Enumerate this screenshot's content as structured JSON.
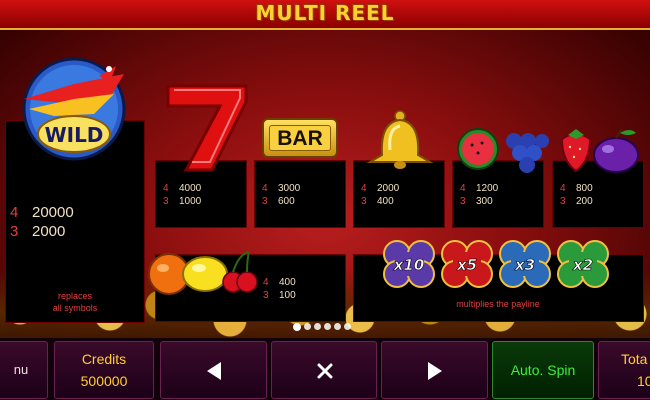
{
  "game": {
    "title": "MULTI REEL"
  },
  "wild": {
    "label": "WILD",
    "pays": [
      {
        "count": "4",
        "value": "20000"
      },
      {
        "count": "3",
        "value": "2000"
      }
    ],
    "desc_line1": "replaces",
    "desc_line2": "all symbols"
  },
  "symbols": {
    "seven": {
      "pays": [
        {
          "count": "4",
          "value": "4000"
        },
        {
          "count": "3",
          "value": "1000"
        }
      ]
    },
    "bar": {
      "label": "BAR",
      "pays": [
        {
          "count": "4",
          "value": "3000"
        },
        {
          "count": "3",
          "value": "600"
        }
      ]
    },
    "bell": {
      "pays": [
        {
          "count": "4",
          "value": "2000"
        },
        {
          "count": "3",
          "value": "400"
        }
      ]
    },
    "melon_grapes": {
      "pays": [
        {
          "count": "4",
          "value": "1200"
        },
        {
          "count": "3",
          "value": "300"
        }
      ]
    },
    "strawberry_plum": {
      "pays": [
        {
          "count": "4",
          "value": "800"
        },
        {
          "count": "3",
          "value": "200"
        }
      ]
    },
    "orange_lemon_cherry": {
      "pays": [
        {
          "count": "4",
          "value": "400"
        },
        {
          "count": "3",
          "value": "100"
        }
      ]
    }
  },
  "multipliers": {
    "items": [
      {
        "label": "x10",
        "color": "#5a3aa8"
      },
      {
        "label": "x5",
        "color": "#c8181c"
      },
      {
        "label": "x3",
        "color": "#2a6ab8"
      },
      {
        "label": "x2",
        "color": "#2a9a3a"
      }
    ],
    "desc": "multiplies the payline"
  },
  "pager": {
    "count": 6,
    "active": 0
  },
  "bottom": {
    "menu_label": "nu",
    "credits_label": "Credits",
    "credits_value": "500000",
    "prev_icon": "arrow-left-icon",
    "close_icon": "close-icon",
    "next_icon": "arrow-right-icon",
    "auto_spin_label": "Auto. Spin",
    "total_label": "Tota",
    "total_value": "10"
  },
  "colors": {
    "accent_gold": "#ffd030",
    "pay_red": "#e04040",
    "auto_spin_green": "#3aee3a"
  }
}
